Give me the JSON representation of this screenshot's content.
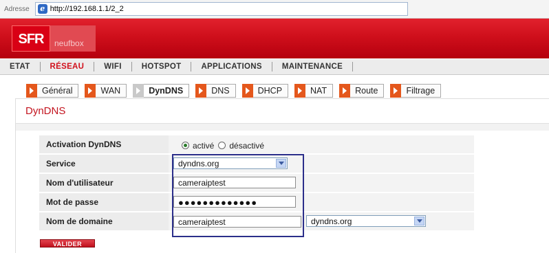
{
  "browser": {
    "address_label": "Adresse",
    "url": "http://192.168.1.1/2_2"
  },
  "header": {
    "logo_text": "SFR",
    "brand_sub": "neufbox",
    "brand_color": "#d90015"
  },
  "menu": {
    "items": [
      {
        "label": "ETAT",
        "active": false
      },
      {
        "label": "RÉSEAU",
        "active": true
      },
      {
        "label": "WIFI",
        "active": false
      },
      {
        "label": "HOTSPOT",
        "active": false
      },
      {
        "label": "APPLICATIONS",
        "active": false
      },
      {
        "label": "MAINTENANCE",
        "active": false
      }
    ]
  },
  "tabs": [
    {
      "label": "Général",
      "active": false
    },
    {
      "label": "WAN",
      "active": false
    },
    {
      "label": "DynDNS",
      "active": true
    },
    {
      "label": "DNS",
      "active": false
    },
    {
      "label": "DHCP",
      "active": false
    },
    {
      "label": "NAT",
      "active": false
    },
    {
      "label": "Route",
      "active": false
    },
    {
      "label": "Filtrage",
      "active": false
    }
  ],
  "panel": {
    "title": "DynDNS"
  },
  "form": {
    "activation": {
      "label": "Activation DynDNS",
      "option_on": "activé",
      "option_off": "désactivé",
      "selected": "activé"
    },
    "service": {
      "label": "Service",
      "value": "dyndns.org"
    },
    "username": {
      "label": "Nom d'utilisateur",
      "value": "cameraiptest"
    },
    "password": {
      "label": "Mot de passe",
      "value": "●●●●●●●●●●●●●"
    },
    "domain": {
      "label": "Nom de domaine",
      "value": "cameraiptest",
      "suffix": "dyndns.org"
    },
    "submit_label": "VALIDER"
  }
}
